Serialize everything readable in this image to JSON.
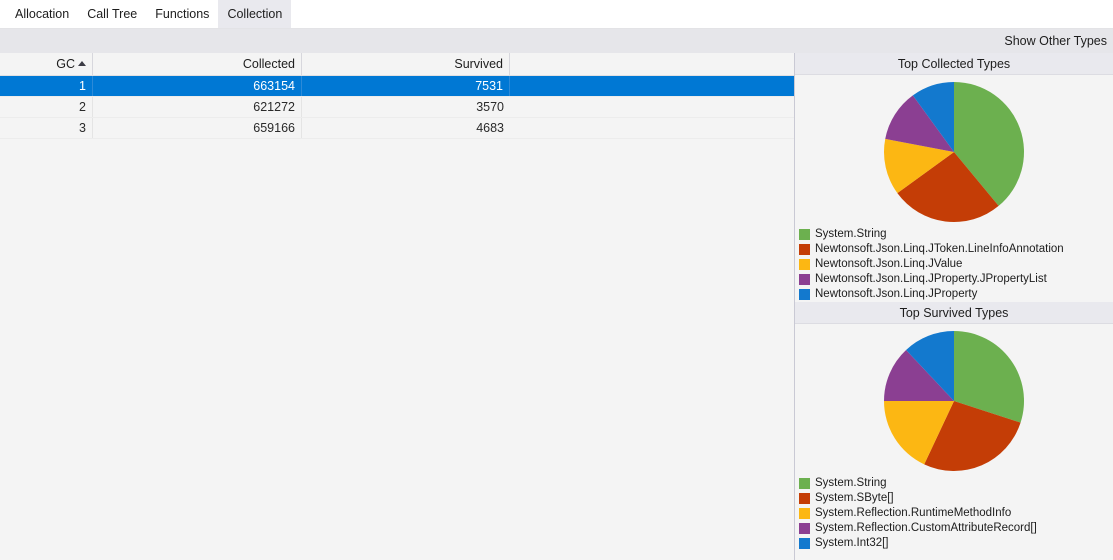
{
  "tabs": [
    {
      "label": "Allocation",
      "active": false
    },
    {
      "label": "Call Tree",
      "active": false
    },
    {
      "label": "Functions",
      "active": false
    },
    {
      "label": "Collection",
      "active": true
    }
  ],
  "toolbar": {
    "show_other_types_label": "Show Other Types"
  },
  "grid": {
    "columns": [
      {
        "label": "GC",
        "sorted": "ascending"
      },
      {
        "label": "Collected",
        "sorted": "none"
      },
      {
        "label": "Survived",
        "sorted": "none"
      }
    ],
    "rows": [
      {
        "gc": "1",
        "collected": "663154",
        "survived": "7531",
        "selected": true
      },
      {
        "gc": "2",
        "collected": "621272",
        "survived": "3570",
        "selected": false
      },
      {
        "gc": "3",
        "collected": "659166",
        "survived": "4683",
        "selected": false
      }
    ]
  },
  "colors": {
    "series": [
      "#6cb04f",
      "#c43d06",
      "#fcb713",
      "#8b3f92",
      "#1379ce"
    ],
    "selection": "#0078d4",
    "panel_header_bg": "#e9e9ee",
    "command_strip_bg": "#e6e6ea",
    "body_bg": "#f4f4f4"
  },
  "chart_data": [
    {
      "type": "pie",
      "title": "Top Collected Types",
      "labels": [
        "System.String",
        "Newtonsoft.Json.Linq.JToken.LineInfoAnnotation",
        "Newtonsoft.Json.Linq.JValue",
        "Newtonsoft.Json.Linq.JProperty.JPropertyList",
        "Newtonsoft.Json.Linq.JProperty"
      ],
      "values": [
        39,
        26,
        13,
        12,
        10
      ],
      "colors": [
        "#6cb04f",
        "#c43d06",
        "#fcb713",
        "#8b3f92",
        "#1379ce"
      ],
      "legend_position": "bottom",
      "start_angle": 0
    },
    {
      "type": "pie",
      "title": "Top Survived Types",
      "labels": [
        "System.String",
        "System.SByte[]",
        "System.Reflection.RuntimeMethodInfo",
        "System.Reflection.CustomAttributeRecord[]",
        "System.Int32[]"
      ],
      "values": [
        30,
        27,
        18,
        13,
        12
      ],
      "colors": [
        "#6cb04f",
        "#c43d06",
        "#fcb713",
        "#8b3f92",
        "#1379ce"
      ],
      "legend_position": "bottom",
      "start_angle": 0
    }
  ]
}
